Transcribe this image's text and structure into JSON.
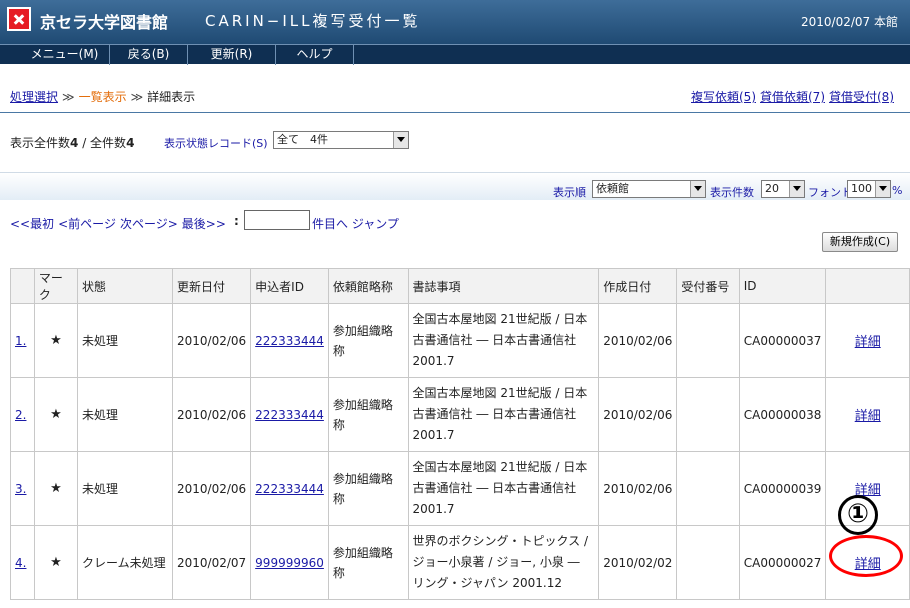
{
  "header": {
    "library_name": "京セラ大学図書館",
    "screen_name": "CARIN−ILL複写受付一覧",
    "date_location": "2010/02/07 本館"
  },
  "menu": [
    "メニュー(M)",
    "戻る(B)",
    "更新(R)",
    "ヘルプ"
  ],
  "breadcrumb": {
    "step1": "処理選択",
    "sep": "≫",
    "step2": "一覧表示",
    "step3": "詳細表示"
  },
  "toplinks": [
    "複写依頼(5)",
    "貸借依頼(7)",
    "貸借受付(8)"
  ],
  "counts": {
    "display_label": "表示全件数",
    "display_value": "4",
    "slash": " / ",
    "total_label": "全件数",
    "total_value": "4"
  },
  "state_filter": {
    "label": "表示状態レコード(S)",
    "value": "全て　4件"
  },
  "options": {
    "order_label": "表示順",
    "order_value": "依頼館",
    "count_label": "表示件数",
    "count_value": "20",
    "font_label": "フォント",
    "font_value": "100",
    "percent": "%"
  },
  "paging": {
    "first": "<<最初",
    "prev": "<前ページ",
    "next": "次ページ>",
    "last": "最後>>",
    "colon": ":",
    "jump": "件目へ ジャンプ"
  },
  "new_button": "新規作成(C)",
  "table": {
    "headers": [
      "",
      "マーク",
      "状態",
      "更新日付",
      "申込者ID",
      "依頼館略称",
      "書誌事項",
      "作成日付",
      "受付番号",
      "ID",
      ""
    ],
    "rows": [
      {
        "no": "1.",
        "mark": "★",
        "status": "未処理",
        "updated": "2010/02/06",
        "applicant": "222333444",
        "org": "参加組織略称",
        "bib": "全国古本屋地図 21世紀版 / 日本古書通信社 ― 日本古書通信社 2001.7",
        "created": "2010/02/06",
        "receipt": "",
        "id": "CA00000037",
        "detail": "詳細"
      },
      {
        "no": "2.",
        "mark": "★",
        "status": "未処理",
        "updated": "2010/02/06",
        "applicant": "222333444",
        "org": "参加組織略称",
        "bib": "全国古本屋地図 21世紀版 / 日本古書通信社 ― 日本古書通信社 2001.7",
        "created": "2010/02/06",
        "receipt": "",
        "id": "CA00000038",
        "detail": "詳細"
      },
      {
        "no": "3.",
        "mark": "★",
        "status": "未処理",
        "updated": "2010/02/06",
        "applicant": "222333444",
        "org": "参加組織略称",
        "bib": "全国古本屋地図 21世紀版 / 日本古書通信社 ― 日本古書通信社 2001.7",
        "created": "2010/02/06",
        "receipt": "",
        "id": "CA00000039",
        "detail": "詳細"
      },
      {
        "no": "4.",
        "mark": "★",
        "status": "クレーム未処理",
        "updated": "2010/02/07",
        "applicant": "999999960",
        "org": "参加組織略称",
        "bib": "世界のボクシング・トピックス / ジョー小泉著 / ジョー, 小泉 ― リング・ジャパン 2001.12",
        "created": "2010/02/02",
        "receipt": "",
        "id": "CA00000027",
        "detail": "詳細"
      }
    ]
  },
  "annotation": {
    "number": "①",
    "highlight_color": "#ff0000"
  }
}
